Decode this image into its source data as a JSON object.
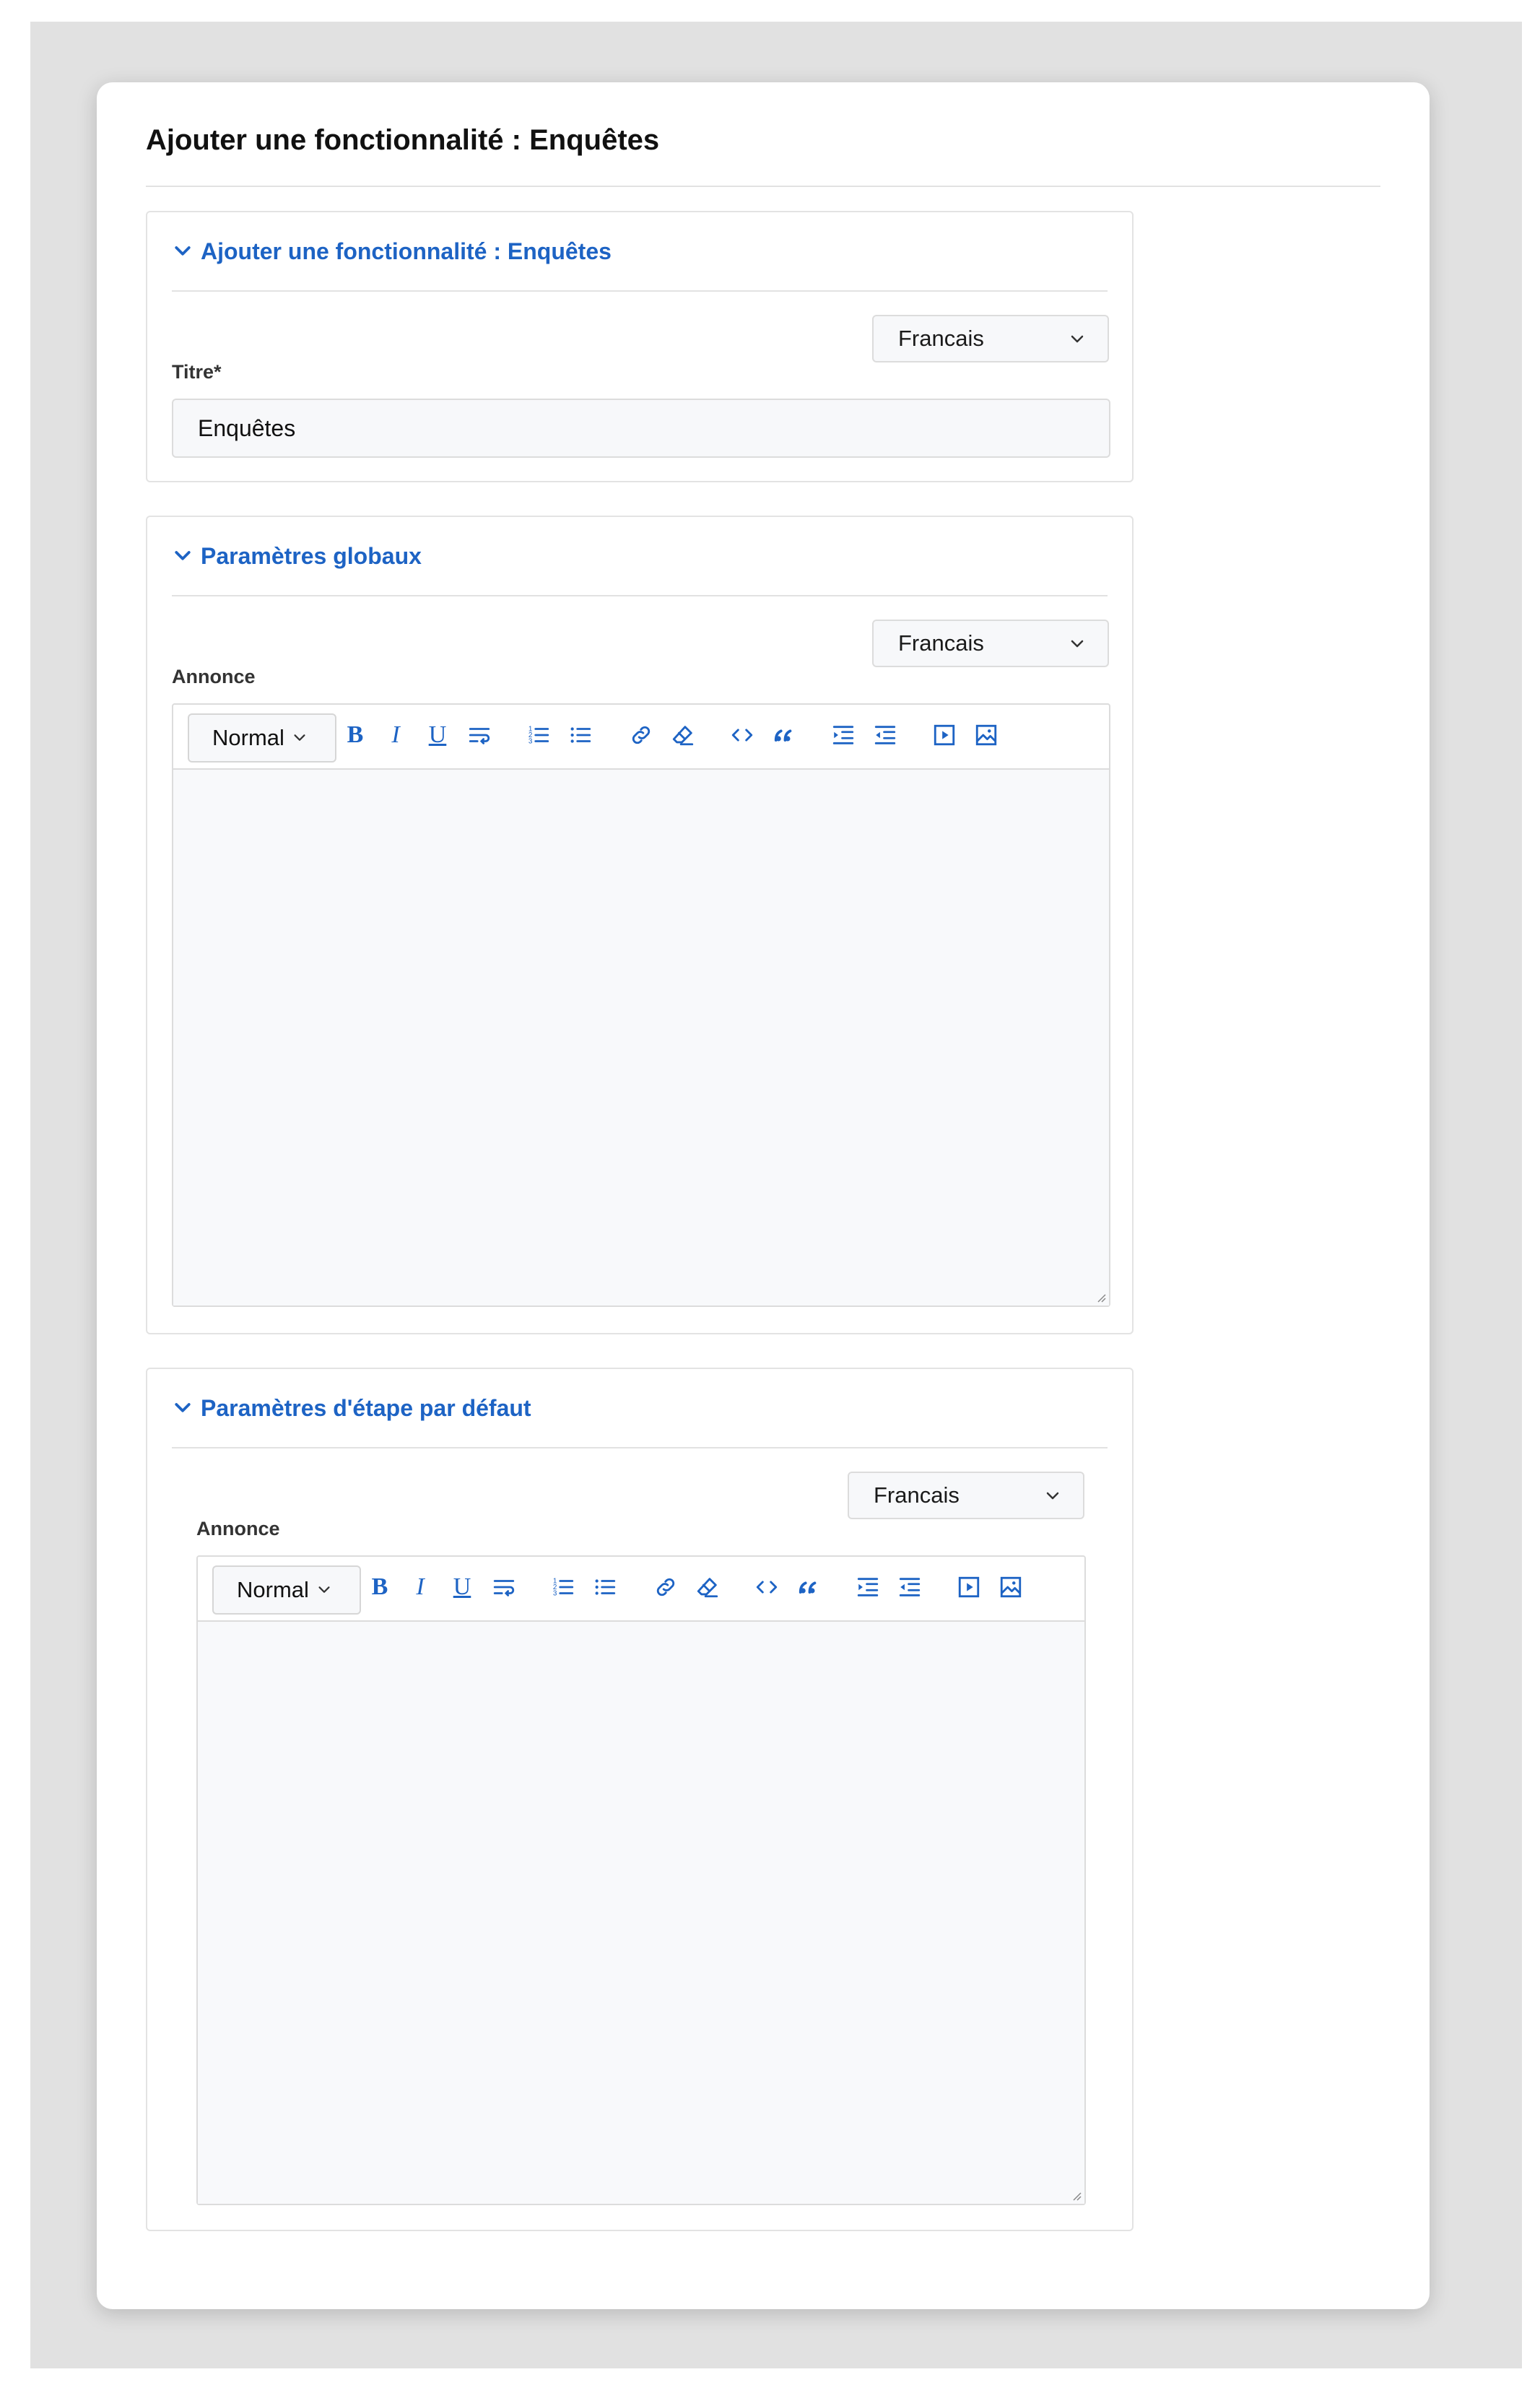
{
  "page": {
    "title": "Ajouter une fonctionnalité : Enquêtes"
  },
  "sections": [
    {
      "title": "Ajouter une fonctionnalité : Enquêtes",
      "language": "Francais",
      "field_label": "Titre*",
      "field_value": "Enquêtes"
    },
    {
      "title": "Paramètres globaux",
      "language": "Francais",
      "field_label": "Annonce",
      "editor": {
        "format": "Normal"
      }
    },
    {
      "title": "Paramètres d'étape par défaut",
      "language": "Francais",
      "field_label": "Annonce",
      "editor": {
        "format": "Normal"
      }
    }
  ],
  "toolbar_buttons": [
    {
      "label": "B",
      "icon": "bold-icon"
    },
    {
      "label": "I",
      "icon": "italic-icon"
    },
    {
      "label": "U",
      "icon": "underline-icon"
    },
    {
      "icon": "strikethrough-wrap-icon"
    },
    {
      "icon": "ordered-list-icon"
    },
    {
      "icon": "bullet-list-icon"
    },
    {
      "icon": "link-icon"
    },
    {
      "icon": "clear-format-icon"
    },
    {
      "icon": "code-icon"
    },
    {
      "icon": "blockquote-icon"
    },
    {
      "icon": "indent-icon"
    },
    {
      "icon": "outdent-icon"
    },
    {
      "icon": "video-icon"
    },
    {
      "icon": "image-icon"
    }
  ],
  "colors": {
    "accent": "#1d63c4",
    "background": "#e1e1e1",
    "field_bg": "#f7f8fa"
  }
}
